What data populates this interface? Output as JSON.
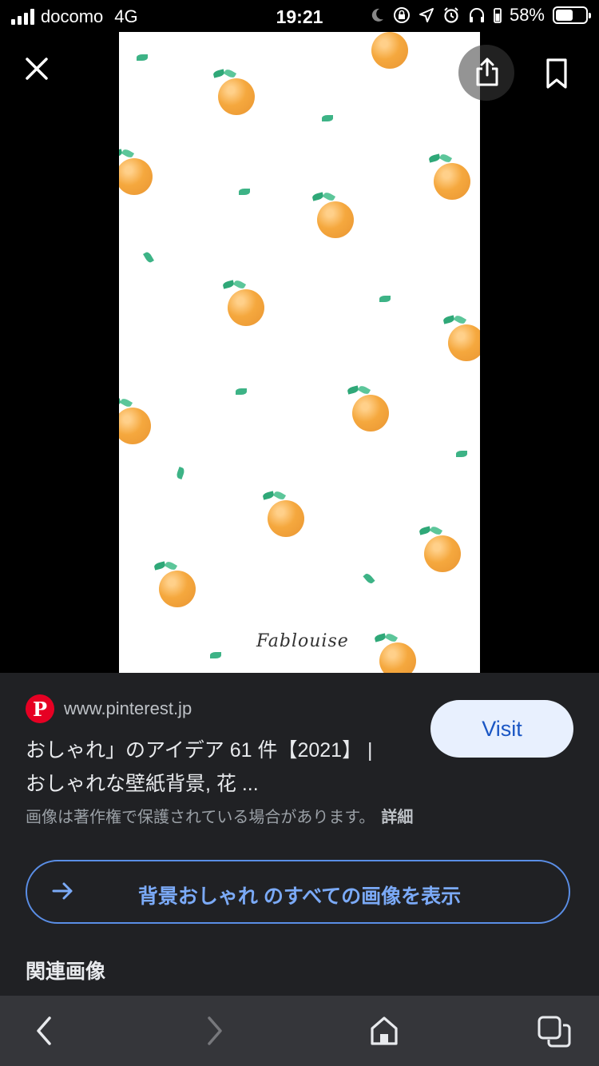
{
  "status_bar": {
    "carrier": "docomo",
    "network": "4G",
    "time": "19:21",
    "battery_percent": "58%",
    "battery_level": 0.58
  },
  "viewer": {
    "image_signature": "Fablouise",
    "icons": {
      "close": "close-icon",
      "share": "share-icon",
      "bookmark": "bookmark-icon"
    }
  },
  "result": {
    "site_logo_letter": "P",
    "site_url": "www.pinterest.jp",
    "title_line1": "おしゃれ」のアイデア 61 件【2021】 |",
    "title_line2": "おしゃれな壁紙背景, 花 ...",
    "copyright_notice": "画像は著作権で保護されている場合があります。",
    "details_link": "詳細",
    "visit_label": "Visit",
    "all_images_label": "背景おしゃれ のすべての画像を表示",
    "related_heading": "関連画像"
  },
  "toolbar": {
    "icons": [
      "back-icon",
      "forward-icon",
      "home-icon",
      "tabs-icon"
    ]
  },
  "colors": {
    "panel_bg": "#202124",
    "toolbar_bg": "#35363a",
    "accent_blue": "#7baaf7",
    "visit_bg": "#e8f0fe",
    "pinterest_red": "#e60023"
  }
}
